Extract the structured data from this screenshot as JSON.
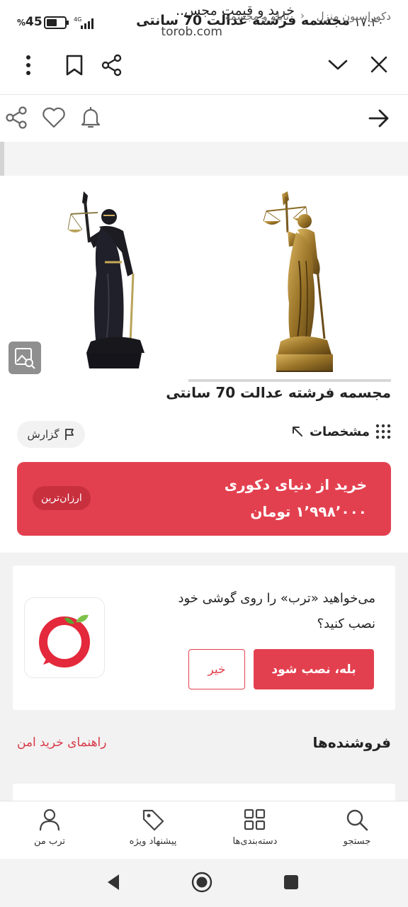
{
  "status_bar": {
    "time": "۱۷:۴۰",
    "battery_percent": "45",
    "percent_sign": "%",
    "network": "4G"
  },
  "browser": {
    "page_title": "خرید و قیمت مجس..",
    "url": "torob.com",
    "icons": [
      "close-icon",
      "chevron-down-icon",
      "share-icon",
      "bookmark-icon",
      "more-vertical-icon"
    ]
  },
  "product_header": {
    "title": "مجسمه فرشته عدالت 70 سانتی",
    "icons": [
      "back-arrow-icon",
      "bell-icon",
      "heart-icon",
      "share-icon"
    ]
  },
  "breadcrumb": {
    "items": [
      "دکوراسیون منزل",
      "تابلو و مجسمه"
    ],
    "separator": "›"
  },
  "product": {
    "title": "مجسمه فرشته عدالت 70 سانتی",
    "images": [
      "gold-justice-statue",
      "black-justice-statue"
    ]
  },
  "actions": {
    "specs_label": "مشخصات",
    "report_label": "گزارش"
  },
  "offer": {
    "shop": "خرید از دنیای دکوری",
    "price": "۱٬۹۹۸٬۰۰۰ تومان",
    "badge": "ارزان‌ترین"
  },
  "install_prompt": {
    "text": "می‌خواهید «ترب» را روی گوشی خود نصب کنید؟",
    "yes_label": "بله، نصب شود",
    "no_label": "خیر"
  },
  "sellers": {
    "title": "فروشنده‌ها",
    "safe_guide": "راهنمای خرید امن"
  },
  "bottom_nav": {
    "items": [
      {
        "label": "جستجو",
        "icon": "search-icon"
      },
      {
        "label": "دسته‌بندی‌ها",
        "icon": "grid-icon"
      },
      {
        "label": "پیشنهاد ویژه",
        "icon": "tag-icon"
      },
      {
        "label": "ترب من",
        "icon": "user-icon"
      }
    ]
  },
  "colors": {
    "accent": "#e3404f",
    "badge": "#c9303e"
  }
}
